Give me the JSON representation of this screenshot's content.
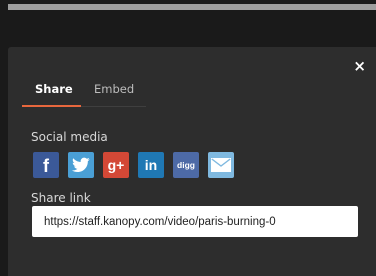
{
  "dialog": {
    "close_glyph": "×",
    "tabs": [
      {
        "label": "Share",
        "active": true
      },
      {
        "label": "Embed",
        "active": false
      }
    ],
    "accent_color": "#e8673d",
    "social_media_label": "Social media",
    "social_icons": [
      {
        "name": "facebook-icon",
        "glyph": "f",
        "color": "#3b5998"
      },
      {
        "name": "twitter-icon",
        "glyph": "bird",
        "color": "#4a9fd5"
      },
      {
        "name": "google-plus-icon",
        "glyph": "g+",
        "color": "#d34836"
      },
      {
        "name": "linkedin-icon",
        "glyph": "in",
        "color": "#1f78b4"
      },
      {
        "name": "digg-icon",
        "glyph": "digg",
        "color": "#4d6aa6"
      },
      {
        "name": "email-icon",
        "glyph": "envelope",
        "color": "#7fb9e0"
      }
    ],
    "share_link_label": "Share link",
    "share_link_value": "https://staff.kanopy.com/video/paris-burning-0"
  }
}
